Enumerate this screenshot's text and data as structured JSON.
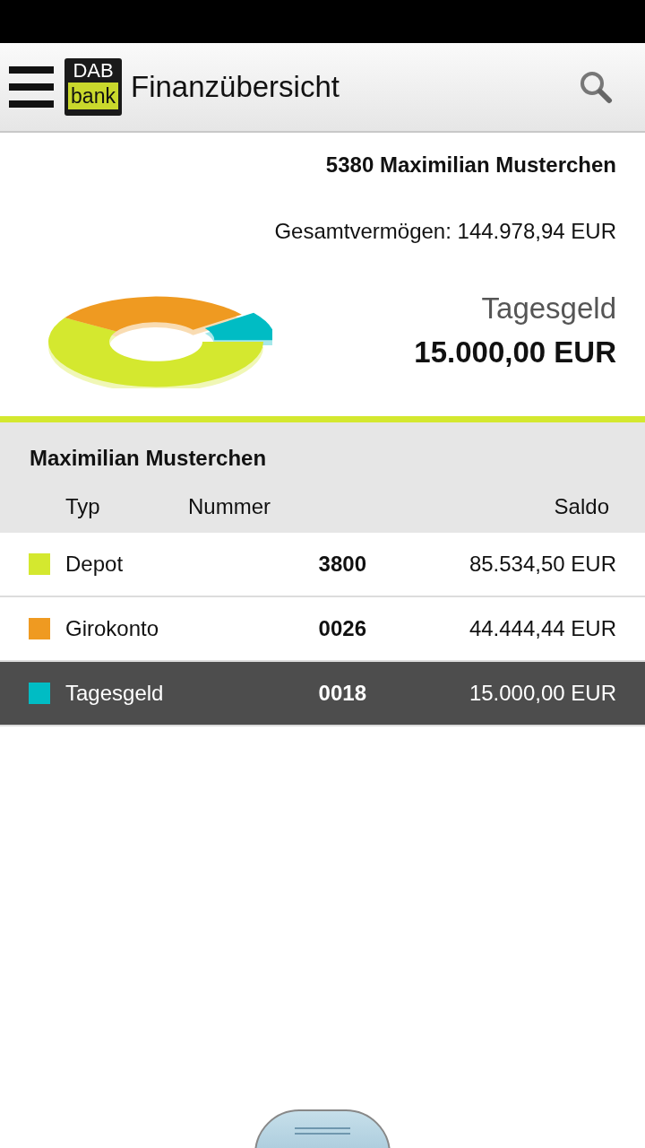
{
  "app_bar": {
    "logo_top": "DAB",
    "logo_bottom": "bank",
    "title": "Finanzübersicht"
  },
  "summary": {
    "owner": "5380 Maximilian Musterchen",
    "total": "Gesamtvermögen: 144.978,94 EUR",
    "selected_type": "Tagesgeld",
    "selected_amount": "15.000,00 EUR"
  },
  "table": {
    "group": "Maximilian Musterchen",
    "columns": [
      "Typ",
      "Nummer",
      "Saldo"
    ],
    "rows": [
      {
        "type": "Depot",
        "number": "3800",
        "balance": "85.534,50 EUR",
        "color": "#d4e82f",
        "selected": false
      },
      {
        "type": "Girokonto",
        "number": "0026",
        "balance": "44.444,44 EUR",
        "color": "#ef9a21",
        "selected": false
      },
      {
        "type": "Tagesgeld",
        "number": "0018",
        "balance": "15.000,00 EUR",
        "color": "#00bcc4",
        "selected": true
      }
    ]
  }
}
